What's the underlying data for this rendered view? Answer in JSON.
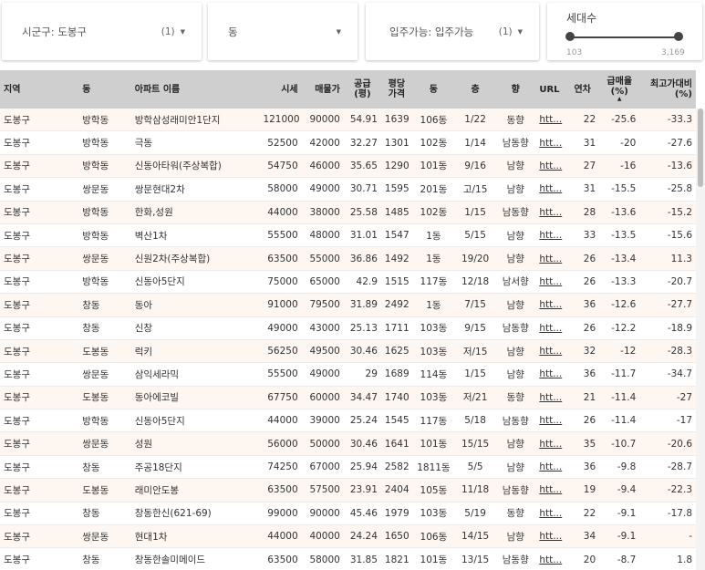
{
  "filters": {
    "district": {
      "label": "시군구: 도봉구",
      "count": "(1)"
    },
    "dong": {
      "label": "동"
    },
    "move_in": {
      "label": "입주가능: 입주가능",
      "count": "(1)"
    },
    "households": {
      "label": "세대수",
      "min": "103",
      "max": "3,169"
    }
  },
  "columns": [
    "지역",
    "동",
    "아파트 이름",
    "시세",
    "매물가",
    "공급(평)",
    "평당가격",
    "동",
    "층",
    "향",
    "URL",
    "연차",
    "급매율(%)",
    "최고가대비(%)"
  ],
  "rows": [
    [
      "도봉구",
      "방학동",
      "방학삼성래미안1단지",
      "121000",
      "90000",
      "54.91",
      "1639",
      "106동",
      "1/22",
      "동향",
      "htt...",
      "22",
      "-25.6",
      "-33.3"
    ],
    [
      "도봉구",
      "방학동",
      "극동",
      "52500",
      "42000",
      "32.27",
      "1301",
      "102동",
      "1/14",
      "남동향",
      "htt...",
      "31",
      "-20",
      "-27.6"
    ],
    [
      "도봉구",
      "방학동",
      "신동아타워(주상복합)",
      "54750",
      "46000",
      "35.65",
      "1290",
      "101동",
      "9/16",
      "남향",
      "htt...",
      "27",
      "-16",
      "-13.6"
    ],
    [
      "도봉구",
      "쌍문동",
      "쌍문현대2차",
      "58000",
      "49000",
      "30.71",
      "1595",
      "201동",
      "고/15",
      "남향",
      "htt...",
      "31",
      "-15.5",
      "-25.8"
    ],
    [
      "도봉구",
      "방학동",
      "한화,성원",
      "44000",
      "38000",
      "25.58",
      "1485",
      "102동",
      "1/15",
      "남동향",
      "htt...",
      "28",
      "-13.6",
      "-15.2"
    ],
    [
      "도봉구",
      "방학동",
      "벽산1차",
      "55500",
      "48000",
      "31.01",
      "1547",
      "1동",
      "5/15",
      "남향",
      "htt...",
      "33",
      "-13.5",
      "-15.6"
    ],
    [
      "도봉구",
      "쌍문동",
      "신원2차(주상복합)",
      "63500",
      "55000",
      "36.86",
      "1492",
      "1동",
      "19/20",
      "남향",
      "htt...",
      "26",
      "-13.4",
      "11.3"
    ],
    [
      "도봉구",
      "방학동",
      "신동아5단지",
      "75000",
      "65000",
      "42.9",
      "1515",
      "117동",
      "12/18",
      "남서향",
      "htt...",
      "26",
      "-13.3",
      "-20.7"
    ],
    [
      "도봉구",
      "창동",
      "동아",
      "91000",
      "79500",
      "31.89",
      "2492",
      "1동",
      "7/15",
      "남향",
      "htt...",
      "36",
      "-12.6",
      "-27.7"
    ],
    [
      "도봉구",
      "창동",
      "신창",
      "49000",
      "43000",
      "25.13",
      "1711",
      "103동",
      "9/15",
      "남동향",
      "htt...",
      "26",
      "-12.2",
      "-18.9"
    ],
    [
      "도봉구",
      "도봉동",
      "럭키",
      "56250",
      "49500",
      "30.46",
      "1625",
      "103동",
      "저/15",
      "남향",
      "htt...",
      "32",
      "-12",
      "-28.3"
    ],
    [
      "도봉구",
      "쌍문동",
      "삼익세라믹",
      "55500",
      "49000",
      "29",
      "1689",
      "114동",
      "1/15",
      "남향",
      "htt...",
      "36",
      "-11.7",
      "-34.7"
    ],
    [
      "도봉구",
      "도봉동",
      "동아에코빌",
      "67750",
      "60000",
      "34.47",
      "1740",
      "103동",
      "저/21",
      "동향",
      "htt...",
      "21",
      "-11.4",
      "-27"
    ],
    [
      "도봉구",
      "방학동",
      "신동아5단지",
      "44000",
      "39000",
      "25.24",
      "1545",
      "117동",
      "5/18",
      "남동향",
      "htt...",
      "26",
      "-11.4",
      "-17"
    ],
    [
      "도봉구",
      "쌍문동",
      "성원",
      "56000",
      "50000",
      "30.46",
      "1641",
      "101동",
      "15/15",
      "남향",
      "htt...",
      "35",
      "-10.7",
      "-20.6"
    ],
    [
      "도봉구",
      "창동",
      "주공18단지",
      "74250",
      "67000",
      "25.94",
      "2582",
      "1811동",
      "5/5",
      "남향",
      "htt...",
      "36",
      "-9.8",
      "-28.7"
    ],
    [
      "도봉구",
      "도봉동",
      "래미안도봉",
      "63500",
      "57500",
      "23.91",
      "2404",
      "105동",
      "11/18",
      "남동향",
      "htt...",
      "19",
      "-9.4",
      "-22.3"
    ],
    [
      "도봉구",
      "창동",
      "창동한신(621-69)",
      "99000",
      "90000",
      "45.46",
      "1979",
      "103동",
      "5/19",
      "동향",
      "htt...",
      "22",
      "-9.1",
      "-17.8"
    ],
    [
      "도봉구",
      "쌍문동",
      "현대1차",
      "44000",
      "40000",
      "24.24",
      "1650",
      "106동",
      "14/15",
      "남향",
      "htt...",
      "34",
      "-9.1",
      "-"
    ],
    [
      "도봉구",
      "창동",
      "창동한솔미메이드",
      "63500",
      "58000",
      "31.85",
      "1821",
      "101동",
      "13/15",
      "남동향",
      "htt...",
      "20",
      "-8.7",
      "1.8"
    ]
  ],
  "scroll_thumb_fraction": 0.17
}
